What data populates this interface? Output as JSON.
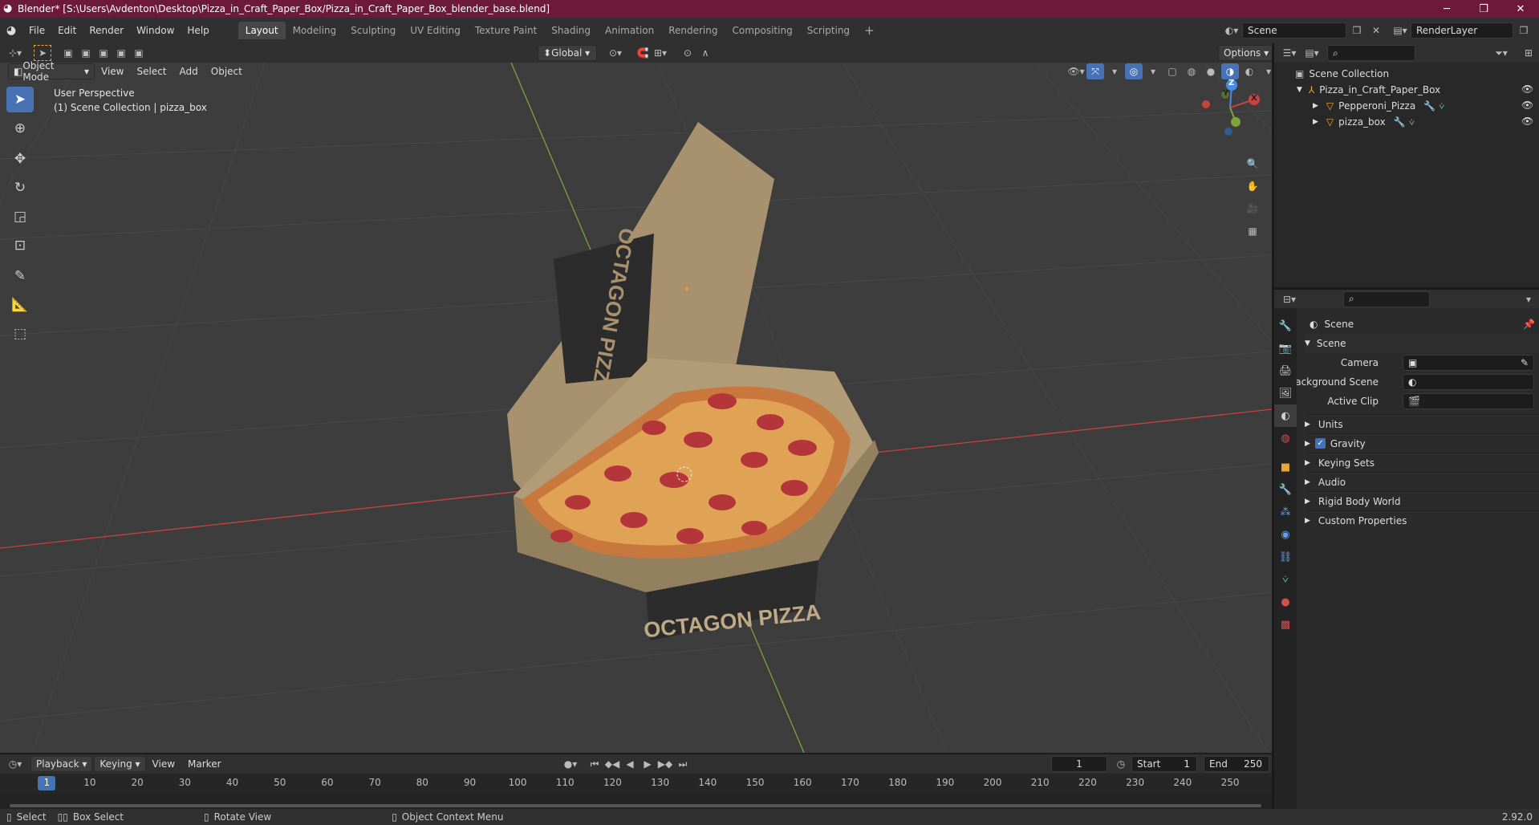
{
  "window": {
    "title": "Blender* [S:\\Users\\Avdenton\\Desktop\\Pizza_in_Craft_Paper_Box/Pizza_in_Craft_Paper_Box_blender_base.blend]",
    "minimize": "─",
    "maximize": "❐",
    "close": "✕"
  },
  "menu": [
    "File",
    "Edit",
    "Render",
    "Window",
    "Help"
  ],
  "workspaces": [
    "Layout",
    "Modeling",
    "Sculpting",
    "UV Editing",
    "Texture Paint",
    "Shading",
    "Animation",
    "Rendering",
    "Compositing",
    "Scripting"
  ],
  "scene_field": "Scene",
  "renderlayer_field": "RenderLayer",
  "viewport_header": {
    "mode": "Object Mode",
    "menus": [
      "View",
      "Select",
      "Add",
      "Object"
    ],
    "transform": "Global",
    "options": "Options"
  },
  "viewport": {
    "perspective": "User Perspective",
    "collection": "(1) Scene Collection | pizza_box",
    "box_label": "OCTAGON PIZZA",
    "lid_label": "OCTAGON PIZZA",
    "gizmo": {
      "z": "Z",
      "y": "Y",
      "x": "X"
    }
  },
  "outliner": {
    "root": "Scene Collection",
    "items": [
      {
        "name": "Pizza_in_Craft_Paper_Box"
      },
      {
        "name": "Pepperoni_Pizza"
      },
      {
        "name": "pizza_box"
      }
    ]
  },
  "properties": {
    "header": "Scene",
    "section": "Scene",
    "camera_label": "Camera",
    "bg_scene_label": "Background Scene",
    "active_clip_label": "Active Clip",
    "subpanels": [
      "Units",
      "Gravity",
      "Keying Sets",
      "Audio",
      "Rigid Body World",
      "Custom Properties"
    ]
  },
  "timeline": {
    "menus": [
      "Playback",
      "Keying",
      "View",
      "Marker"
    ],
    "current_frame": "1",
    "start_label": "Start",
    "start": "1",
    "end_label": "End",
    "end": "250",
    "ticks": [
      "1",
      "10",
      "20",
      "30",
      "40",
      "50",
      "60",
      "70",
      "80",
      "90",
      "100",
      "110",
      "120",
      "130",
      "140",
      "150",
      "160",
      "170",
      "180",
      "190",
      "200",
      "210",
      "220",
      "230",
      "240",
      "250"
    ]
  },
  "status": {
    "select": "Select",
    "box_select": "Box Select",
    "rotate": "Rotate View",
    "context": "Object Context Menu",
    "version": "2.92.0"
  },
  "colors": {
    "accent": "#4772b3",
    "titlebar": "#6d1a3a",
    "x_axis": "#c8433f",
    "y_axis": "#7ca43a"
  }
}
